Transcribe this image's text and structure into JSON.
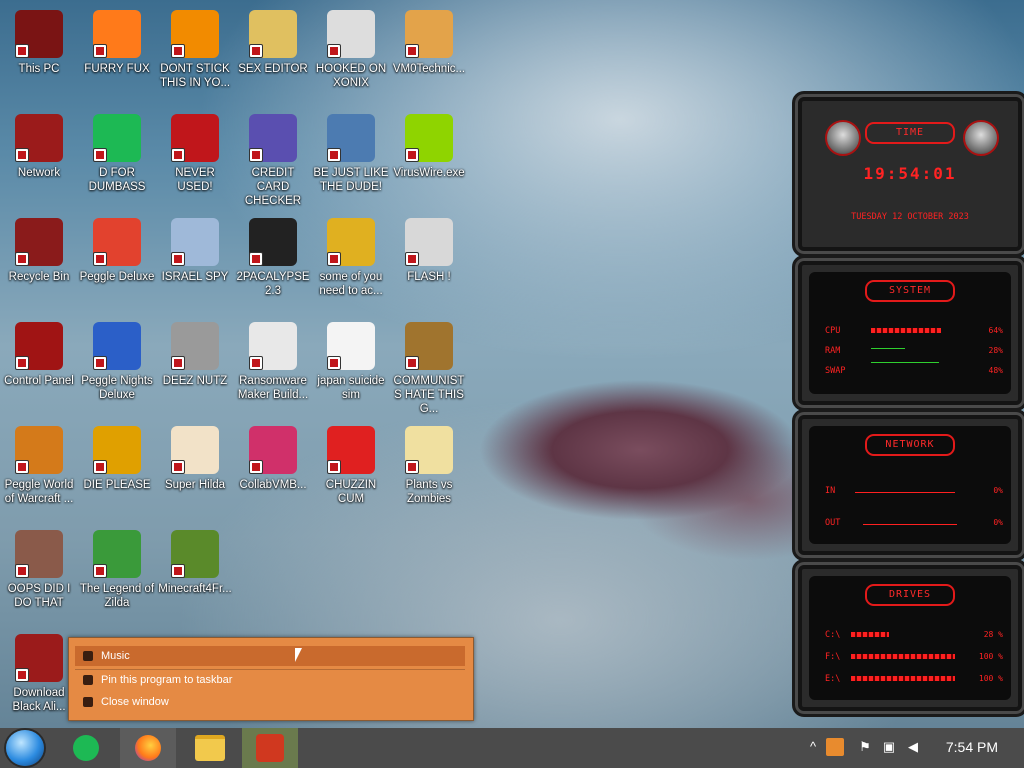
{
  "desktop": {
    "icons": [
      {
        "label": "This PC",
        "icon": "monitor-icon",
        "color": "#7a1414"
      },
      {
        "label": "FURRY FUX",
        "icon": "firefox-icon",
        "color": "#ff7a1a"
      },
      {
        "label": "DONT STICK THIS IN YO...",
        "icon": "traffic-cone-icon",
        "color": "#f28b00"
      },
      {
        "label": "SEX EDITOR",
        "icon": "hxd-icon",
        "color": "#e0c060"
      },
      {
        "label": "HOOKED ON XONIX",
        "icon": "xonix-icon",
        "color": "#dddddd"
      },
      {
        "label": "VM0Technic...",
        "icon": "doctor-icon",
        "color": "#e3a34a"
      },
      {
        "label": "Network",
        "icon": "alien-icon",
        "color": "#9b1b1b"
      },
      {
        "label": "D FOR DUMBASS",
        "icon": "discord-icon",
        "color": "#1db954"
      },
      {
        "label": "NEVER USED!",
        "icon": "devcpp-icon",
        "color": "#c0161b"
      },
      {
        "label": "CREDIT CARD CHECKER",
        "icon": "credit-card-icon",
        "color": "#5a4fb0"
      },
      {
        "label": "BE JUST LIKE THE DUDE!",
        "icon": "mcafee-icon",
        "color": "#4c7bb1"
      },
      {
        "label": "VirusWire.exe",
        "icon": "limewire-icon",
        "color": "#8fd400"
      },
      {
        "label": "Recycle Bin",
        "icon": "recycle-bin-icon",
        "color": "#8a1b1b"
      },
      {
        "label": "Peggle Deluxe",
        "icon": "peggle-icon",
        "color": "#e2422e"
      },
      {
        "label": "ISRAEL SPY",
        "icon": "network-spy-icon",
        "color": "#9fb9d9"
      },
      {
        "label": "2PACALYPSE 2.3",
        "icon": "terminal-icon",
        "color": "#222222"
      },
      {
        "label": "some of you need to ac...",
        "icon": "dog-icon",
        "color": "#e0b020"
      },
      {
        "label": "FLASH !",
        "icon": "flash-icon",
        "color": "#d8d8d8"
      },
      {
        "label": "Control Panel",
        "icon": "control-panel-icon",
        "color": "#a01414"
      },
      {
        "label": "Peggle Nights Deluxe",
        "icon": "peggle-icon",
        "color": "#2b5fc8"
      },
      {
        "label": "DEEZ NUTZ",
        "icon": "stack-icon",
        "color": "#9a9a9a"
      },
      {
        "label": "Ransomware Maker Build...",
        "icon": "window-icon",
        "color": "#e8e8e8"
      },
      {
        "label": "japan suicide sim",
        "icon": "game-icon",
        "color": "#f4f4f4"
      },
      {
        "label": "COMMUNISTS HATE THIS G...",
        "icon": "money-bag-icon",
        "color": "#a0742e"
      },
      {
        "label": "Peggle World of Warcraft ...",
        "icon": "peggle-icon",
        "color": "#d47a1a"
      },
      {
        "label": "DIE PLEASE",
        "icon": "de-icon",
        "color": "#e0a000"
      },
      {
        "label": "Super Hilda",
        "icon": "pixel-cat-icon",
        "color": "#f2e2c8"
      },
      {
        "label": "CollabVMB...",
        "icon": "collabvm-icon",
        "color": "#d0306a"
      },
      {
        "label": "CHUZZIN CUM",
        "icon": "chuzzle-icon",
        "color": "#e02020"
      },
      {
        "label": "Plants vs Zombies",
        "icon": "flower-icon",
        "color": "#f0e0a0"
      },
      {
        "label": "OOPS DID I DO THAT",
        "icon": "portrait-icon",
        "color": "#8a5a4a"
      },
      {
        "label": "The Legend of Zilda",
        "icon": "zelda-icon",
        "color": "#3a9a3a"
      },
      {
        "label": "Minecraft4Fr...",
        "icon": "minecraft-icon",
        "color": "#5a8a2a"
      },
      {
        "label": "Download Black Ali...",
        "icon": "alien-icon",
        "color": "#9b1b1b"
      }
    ]
  },
  "gadget": {
    "time": {
      "title": "TIME",
      "clock": "19:54:01",
      "date": "TUESDAY 12 OCTOBER 2023"
    },
    "system": {
      "title": "SYSTEM",
      "rows": [
        {
          "label": "CPU",
          "value": "64%",
          "level": 0.64
        },
        {
          "label": "RAM",
          "value": "28%",
          "level": 0.28
        },
        {
          "label": "SWAP",
          "value": "48%",
          "level": 0.48
        }
      ]
    },
    "network": {
      "title": "NETWORK",
      "rows": [
        {
          "label": "IN",
          "value": "0%"
        },
        {
          "label": "OUT",
          "value": "0%"
        }
      ]
    },
    "drives": {
      "title": "DRIVES",
      "rows": [
        {
          "label": "C:\\",
          "value": "28 %",
          "level": 0.28
        },
        {
          "label": "F:\\",
          "value": "100 %",
          "level": 1.0
        },
        {
          "label": "E:\\",
          "value": "100 %",
          "level": 1.0
        }
      ]
    }
  },
  "context_menu": {
    "items": [
      {
        "label": "Music",
        "icon": "headphones-icon"
      },
      {
        "label": "Pin this program to taskbar",
        "icon": "pin-icon"
      },
      {
        "label": "Close window",
        "icon": "close-icon"
      }
    ]
  },
  "taskbar": {
    "clock": "7:54 PM",
    "apps": [
      {
        "name": "spotify",
        "icon": "spotify-icon",
        "color": "#1db954"
      },
      {
        "name": "firefox",
        "icon": "firefox-icon",
        "color": "#ff7a1a"
      },
      {
        "name": "explorer",
        "icon": "folder-icon",
        "color": "#f2c94c"
      },
      {
        "name": "music",
        "icon": "headphones-icon",
        "color": "#d0381f"
      }
    ],
    "tray": [
      "chevron-up-icon",
      "app-tray-icon",
      "flag-icon",
      "network-icon",
      "speaker-icon"
    ]
  }
}
